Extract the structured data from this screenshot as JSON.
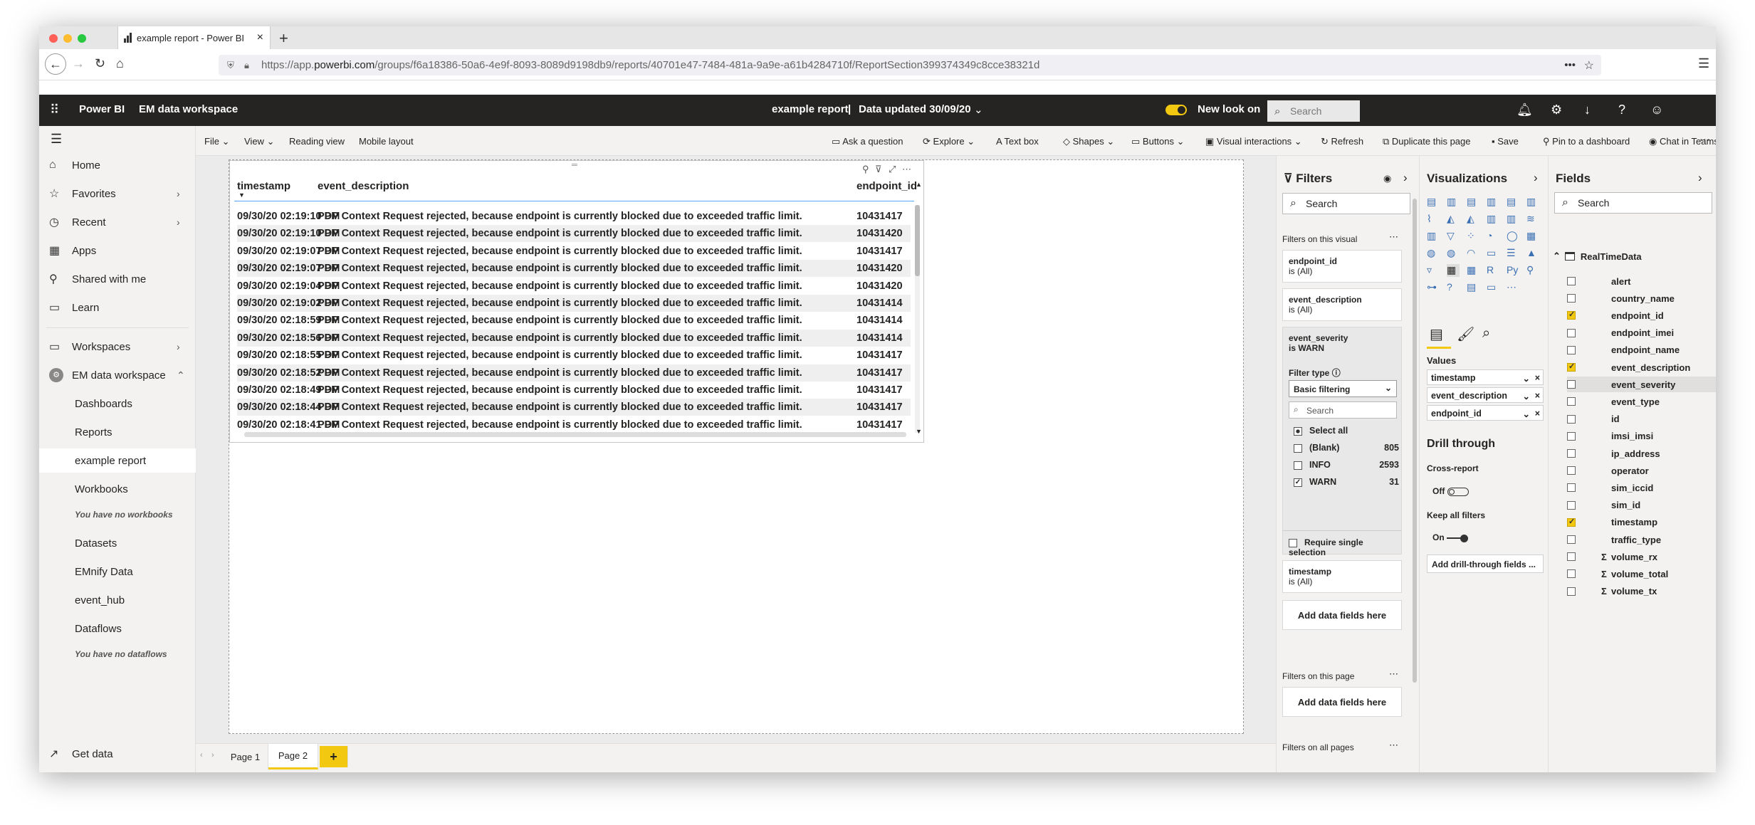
{
  "browser": {
    "tab_title": "example report - Power BI",
    "url_prefix": "https://app.",
    "url_domain": "powerbi.com",
    "url_path": "/groups/f6a18386-50a6-4e9f-8093-8089d9198db9/reports/40701e47-7484-481a-9a9e-a61b4284710f/ReportSection399374349c8cce38321d"
  },
  "header": {
    "app_name": "Power BI",
    "workspace": "EM data workspace",
    "report_title": "example report",
    "data_updated": "Data updated 30/09/20",
    "new_look": "New look on",
    "search_placeholder": "Search"
  },
  "leftnav": {
    "home": "Home",
    "favorites": "Favorites",
    "recent": "Recent",
    "apps": "Apps",
    "shared": "Shared with me",
    "learn": "Learn",
    "workspaces": "Workspaces",
    "em_workspace": "EM data workspace",
    "dashboards": "Dashboards",
    "reports": "Reports",
    "example_report": "example report",
    "workbooks": "Workbooks",
    "no_workbooks": "You have no workbooks",
    "datasets": "Datasets",
    "emnify": "EMnify Data",
    "event_hub": "event_hub",
    "dataflows": "Dataflows",
    "no_dataflows": "You have no dataflows",
    "get_data": "Get data"
  },
  "commandbar": {
    "file": "File",
    "view": "View",
    "reading_view": "Reading view",
    "mobile_layout": "Mobile layout",
    "ask": "Ask a question",
    "explore": "Explore",
    "text_box": "Text box",
    "shapes": "Shapes",
    "buttons": "Buttons",
    "visual_interactions": "Visual interactions",
    "refresh": "Refresh",
    "duplicate": "Duplicate this page",
    "save": "Save",
    "pin": "Pin to a dashboard",
    "chat": "Chat in Teams"
  },
  "table": {
    "headers": [
      "timestamp",
      "event_description",
      "endpoint_id"
    ],
    "description": "PDP Context Request rejected, because endpoint is currently blocked due to exceeded traffic limit.",
    "rows": [
      {
        "ts": "09/30/20 02:19:10 PM",
        "id": "10431417"
      },
      {
        "ts": "09/30/20 02:19:10 PM",
        "id": "10431420"
      },
      {
        "ts": "09/30/20 02:19:07 PM",
        "id": "10431417"
      },
      {
        "ts": "09/30/20 02:19:07 PM",
        "id": "10431420"
      },
      {
        "ts": "09/30/20 02:19:04 PM",
        "id": "10431420"
      },
      {
        "ts": "09/30/20 02:19:02 PM",
        "id": "10431414"
      },
      {
        "ts": "09/30/20 02:18:59 PM",
        "id": "10431414"
      },
      {
        "ts": "09/30/20 02:18:56 PM",
        "id": "10431414"
      },
      {
        "ts": "09/30/20 02:18:55 PM",
        "id": "10431417"
      },
      {
        "ts": "09/30/20 02:18:52 PM",
        "id": "10431417"
      },
      {
        "ts": "09/30/20 02:18:49 PM",
        "id": "10431417"
      },
      {
        "ts": "09/30/20 02:18:44 PM",
        "id": "10431417"
      },
      {
        "ts": "09/30/20 02:18:41 PM",
        "id": "10431417"
      }
    ]
  },
  "pages": [
    "Page 1",
    "Page 2"
  ],
  "filters": {
    "title": "Filters",
    "search": "Search",
    "on_visual": "Filters on this visual",
    "f1_name": "endpoint_id",
    "f1_val": "is (All)",
    "f2_name": "event_description",
    "f2_val": "is (All)",
    "f3_name": "event_severity",
    "f3_val": "is WARN",
    "filter_type": "Filter type",
    "basic": "Basic filtering",
    "inner_search": "Search",
    "options": [
      {
        "label": "Select all",
        "count": ""
      },
      {
        "label": "(Blank)",
        "count": "805"
      },
      {
        "label": "INFO",
        "count": "2593"
      },
      {
        "label": "WARN",
        "count": "31"
      }
    ],
    "require_single": "Require single selection",
    "f4_name": "timestamp",
    "f4_val": "is (All)",
    "add_fields": "Add data fields here",
    "on_page": "Filters on this page",
    "on_all": "Filters on all pages"
  },
  "viz": {
    "title": "Visualizations",
    "values": "Values",
    "wells": [
      "timestamp",
      "event_description",
      "endpoint_id"
    ],
    "drill": "Drill through",
    "cross": "Cross-report",
    "off": "Off",
    "keep": "Keep all filters",
    "on": "On",
    "add_drill": "Add drill-through fields ..."
  },
  "fields": {
    "title": "Fields",
    "search": "Search",
    "table": "RealTimeData",
    "items": [
      {
        "name": "alert",
        "checked": false,
        "sigma": false
      },
      {
        "name": "country_name",
        "checked": false,
        "sigma": false
      },
      {
        "name": "endpoint_id",
        "checked": true,
        "sigma": false
      },
      {
        "name": "endpoint_imei",
        "checked": false,
        "sigma": false
      },
      {
        "name": "endpoint_name",
        "checked": false,
        "sigma": false
      },
      {
        "name": "event_description",
        "checked": true,
        "sigma": false
      },
      {
        "name": "event_severity",
        "checked": false,
        "sigma": false
      },
      {
        "name": "event_type",
        "checked": false,
        "sigma": false
      },
      {
        "name": "id",
        "checked": false,
        "sigma": false
      },
      {
        "name": "imsi_imsi",
        "checked": false,
        "sigma": false
      },
      {
        "name": "ip_address",
        "checked": false,
        "sigma": false
      },
      {
        "name": "operator",
        "checked": false,
        "sigma": false
      },
      {
        "name": "sim_iccid",
        "checked": false,
        "sigma": false
      },
      {
        "name": "sim_id",
        "checked": false,
        "sigma": false
      },
      {
        "name": "timestamp",
        "checked": true,
        "sigma": false
      },
      {
        "name": "traffic_type",
        "checked": false,
        "sigma": false
      },
      {
        "name": "volume_rx",
        "checked": false,
        "sigma": true
      },
      {
        "name": "volume_total",
        "checked": false,
        "sigma": true
      },
      {
        "name": "volume_tx",
        "checked": false,
        "sigma": true
      }
    ]
  },
  "colors": {
    "accent": "#f2c811",
    "header_bg": "#252423",
    "pane_bg": "#f3f2f1"
  }
}
